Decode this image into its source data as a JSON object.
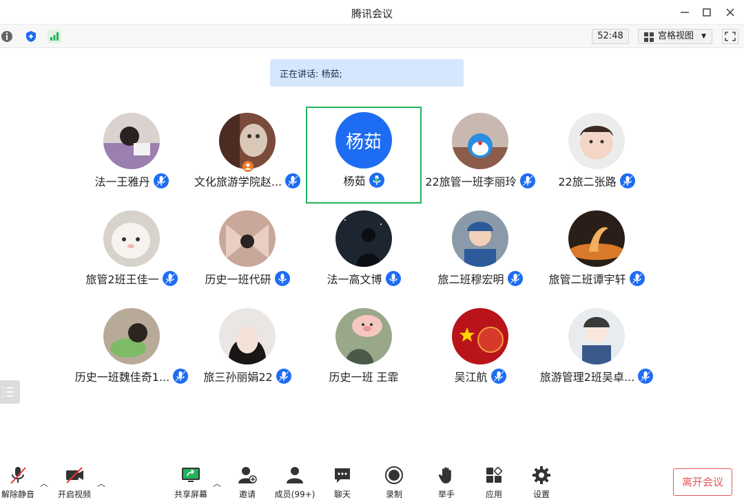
{
  "window": {
    "title": "腾讯会议"
  },
  "toolbar": {
    "timer": "52:48",
    "view_mode": "宫格视图"
  },
  "speaking_banner": "正在讲话: 杨茹;",
  "participants": [
    {
      "name": "法一王雅丹",
      "mic": "on"
    },
    {
      "name": "文化旅游学院赵...",
      "mic": "on",
      "host_badge": true
    },
    {
      "name": "杨茹",
      "mic": "speaking",
      "initials": "杨茹",
      "active": true
    },
    {
      "name": "22旅管一班李丽玲",
      "mic": "on"
    },
    {
      "name": "22旅二张路",
      "mic": "on"
    },
    {
      "name": "旅管2班王佳一",
      "mic": "on"
    },
    {
      "name": "历史一班代研",
      "mic": "on"
    },
    {
      "name": "法一高文博",
      "mic": "on"
    },
    {
      "name": "旅二班穆宏明",
      "mic": "on"
    },
    {
      "name": "旅管二班谭宇轩",
      "mic": "on"
    },
    {
      "name": "历史一班魏佳奇1...",
      "mic": "on"
    },
    {
      "name": "旅三孙丽娟22",
      "mic": "on"
    },
    {
      "name": "历史一班 王霏",
      "mic": "none"
    },
    {
      "name": "吴江航",
      "mic": "on"
    },
    {
      "name": "旅游管理2班吴卓...",
      "mic": "on"
    }
  ],
  "bottom": {
    "unmute": "解除静音",
    "start_video": "开启视频",
    "share_screen": "共享屏幕",
    "invite": "邀请",
    "members": "成员(99+)",
    "chat": "聊天",
    "record": "录制",
    "raise_hand": "举手",
    "apps": "应用",
    "settings": "设置",
    "leave": "离开会议"
  },
  "colors": {
    "accent": "#1e6cf2",
    "active_border": "#21b25c",
    "leave": "#e45656",
    "banner": "#d6e6fc"
  }
}
